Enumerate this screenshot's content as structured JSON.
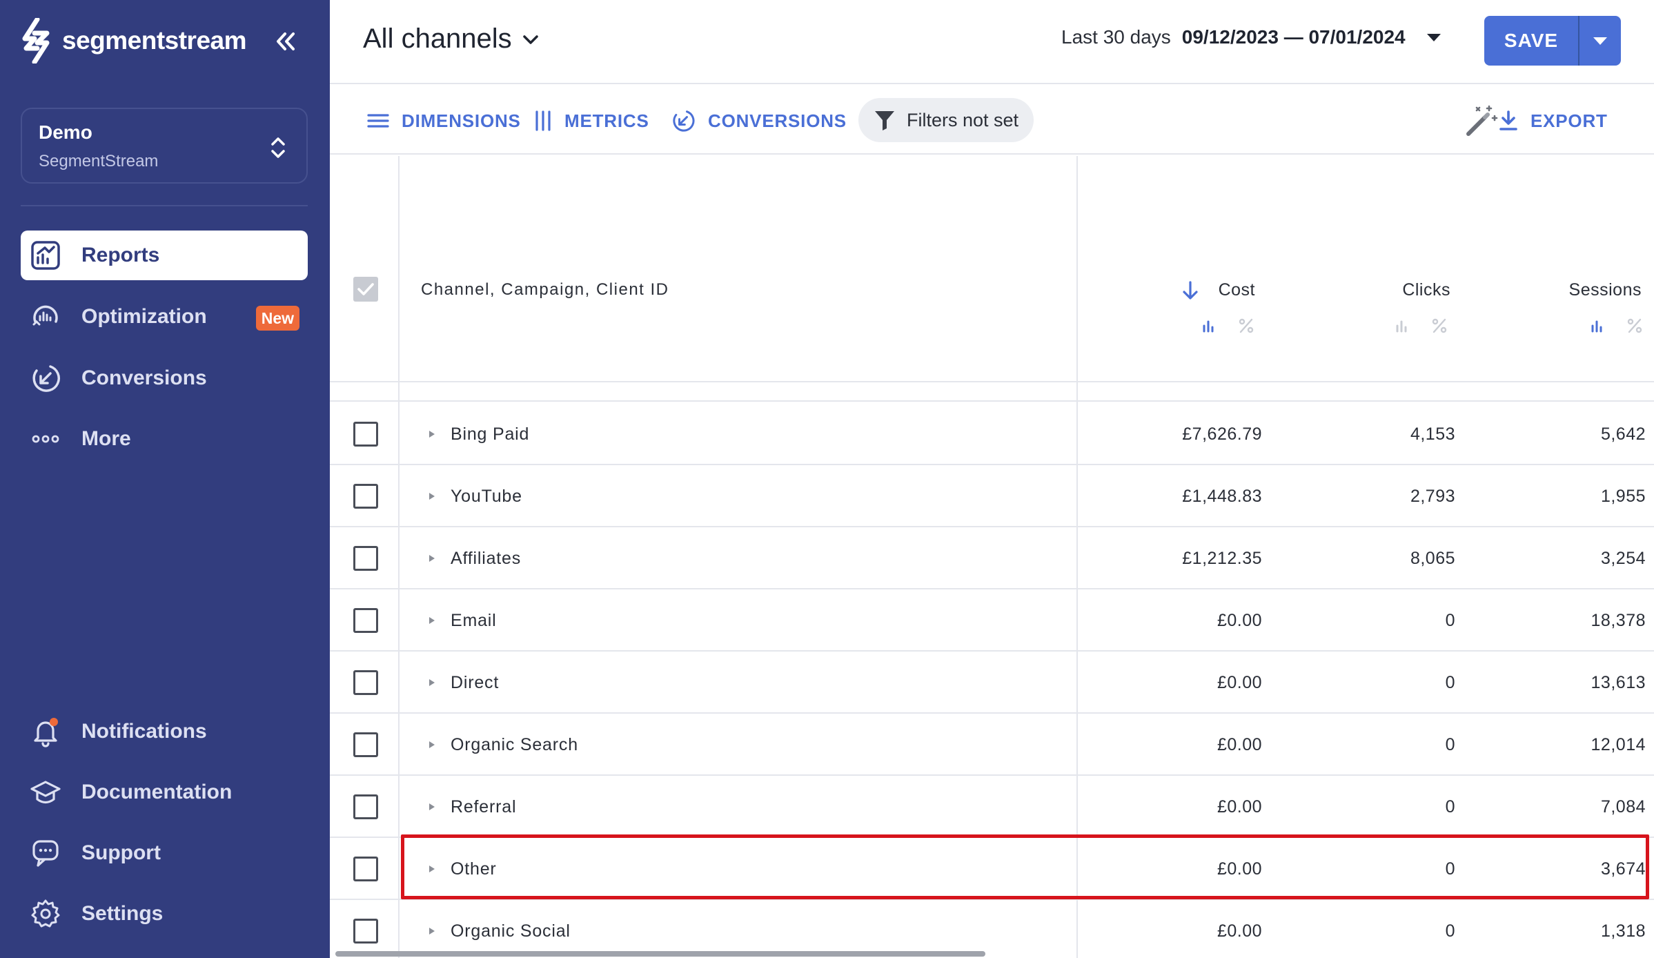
{
  "app": {
    "brand": "segmentstream"
  },
  "workspace": {
    "name": "Demo",
    "subtitle": "SegmentStream"
  },
  "nav": {
    "reports": "Reports",
    "optimization": "Optimization",
    "optimization_badge": "New",
    "conversions": "Conversions",
    "more": "More",
    "notifications": "Notifications",
    "documentation": "Documentation",
    "support": "Support",
    "settings": "Settings"
  },
  "header": {
    "title": "All channels",
    "date_preset": "Last 30 days",
    "date_range": "09/12/2023 — 07/01/2024",
    "save_label": "SAVE"
  },
  "toolbar": {
    "dimensions": "DIMENSIONS",
    "metrics": "METRICS",
    "conversions": "CONVERSIONS",
    "filters": "Filters not set",
    "export": "EXPORT"
  },
  "table": {
    "dimension_header": "Channel, Campaign, Client ID",
    "columns": [
      "Cost",
      "Clicks",
      "Sessions"
    ],
    "rows": [
      {
        "name": "Bing Paid",
        "cost": "£7,626.79",
        "clicks": "4,153",
        "sessions": "5,642"
      },
      {
        "name": "YouTube",
        "cost": "£1,448.83",
        "clicks": "2,793",
        "sessions": "1,955"
      },
      {
        "name": "Affiliates",
        "cost": "£1,212.35",
        "clicks": "8,065",
        "sessions": "3,254"
      },
      {
        "name": "Email",
        "cost": "£0.00",
        "clicks": "0",
        "sessions": "18,378"
      },
      {
        "name": "Direct",
        "cost": "£0.00",
        "clicks": "0",
        "sessions": "13,613"
      },
      {
        "name": "Organic Search",
        "cost": "£0.00",
        "clicks": "0",
        "sessions": "12,014"
      },
      {
        "name": "Referral",
        "cost": "£0.00",
        "clicks": "0",
        "sessions": "7,084"
      },
      {
        "name": "Other",
        "cost": "£0.00",
        "clicks": "0",
        "sessions": "3,674"
      },
      {
        "name": "Organic Social",
        "cost": "£0.00",
        "clicks": "0",
        "sessions": "1,318"
      }
    ]
  },
  "colors": {
    "sidebar_bg": "#323d7e",
    "accent": "#4a6fd6",
    "badge": "#ee6a3a",
    "highlight": "#d7141c"
  },
  "icons": {
    "logo": "lightning-s-logo-icon",
    "collapse": "double-chevron-left-icon",
    "workspace_switch": "up-down-chevron-icon",
    "reports": "chart-report-icon",
    "optimization": "gauge-icon",
    "conversions": "check-arrow-circle-icon",
    "more": "three-dots-icon",
    "notifications": "bell-icon",
    "documentation": "graduation-cap-icon",
    "support": "chat-bubble-icon",
    "settings": "gear-icon",
    "dimensions": "hamburger-lines-icon",
    "metrics": "vertical-bars-icon",
    "filter": "funnel-icon",
    "magic": "magic-wand-icon",
    "export": "download-icon",
    "sort": "arrow-down-icon",
    "bar_toggle": "bar-chart-icon",
    "percent_toggle": "percent-icon",
    "expand": "triangle-right-icon"
  }
}
